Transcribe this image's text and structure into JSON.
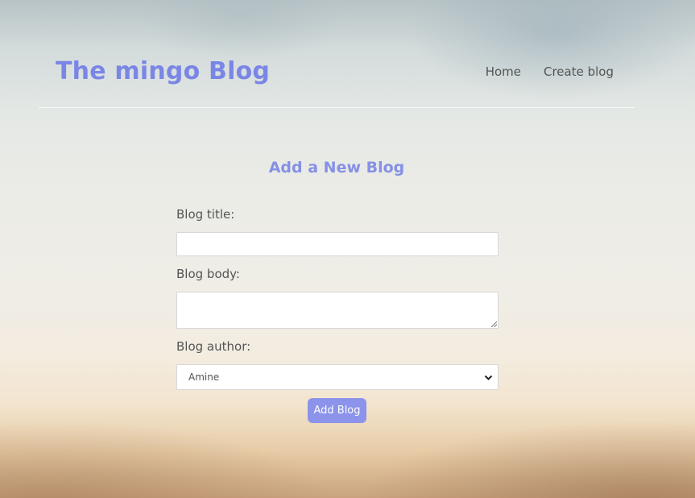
{
  "header": {
    "logo": "The mingo Blog",
    "nav": [
      {
        "label": "Home"
      },
      {
        "label": "Create blog"
      }
    ]
  },
  "form": {
    "title": "Add a New Blog",
    "title_label": "Blog title:",
    "title_value": "",
    "body_label": "Blog body:",
    "body_value": "",
    "author_label": "Blog author:",
    "author_value": "Amine",
    "submit_label": "Add Blog"
  },
  "colors": {
    "accent": "#7a86e6",
    "button": "#8b93ea"
  },
  "icons": {
    "select_arrow": "chevron-down-icon",
    "textarea_grip": "resize-grip-icon"
  }
}
